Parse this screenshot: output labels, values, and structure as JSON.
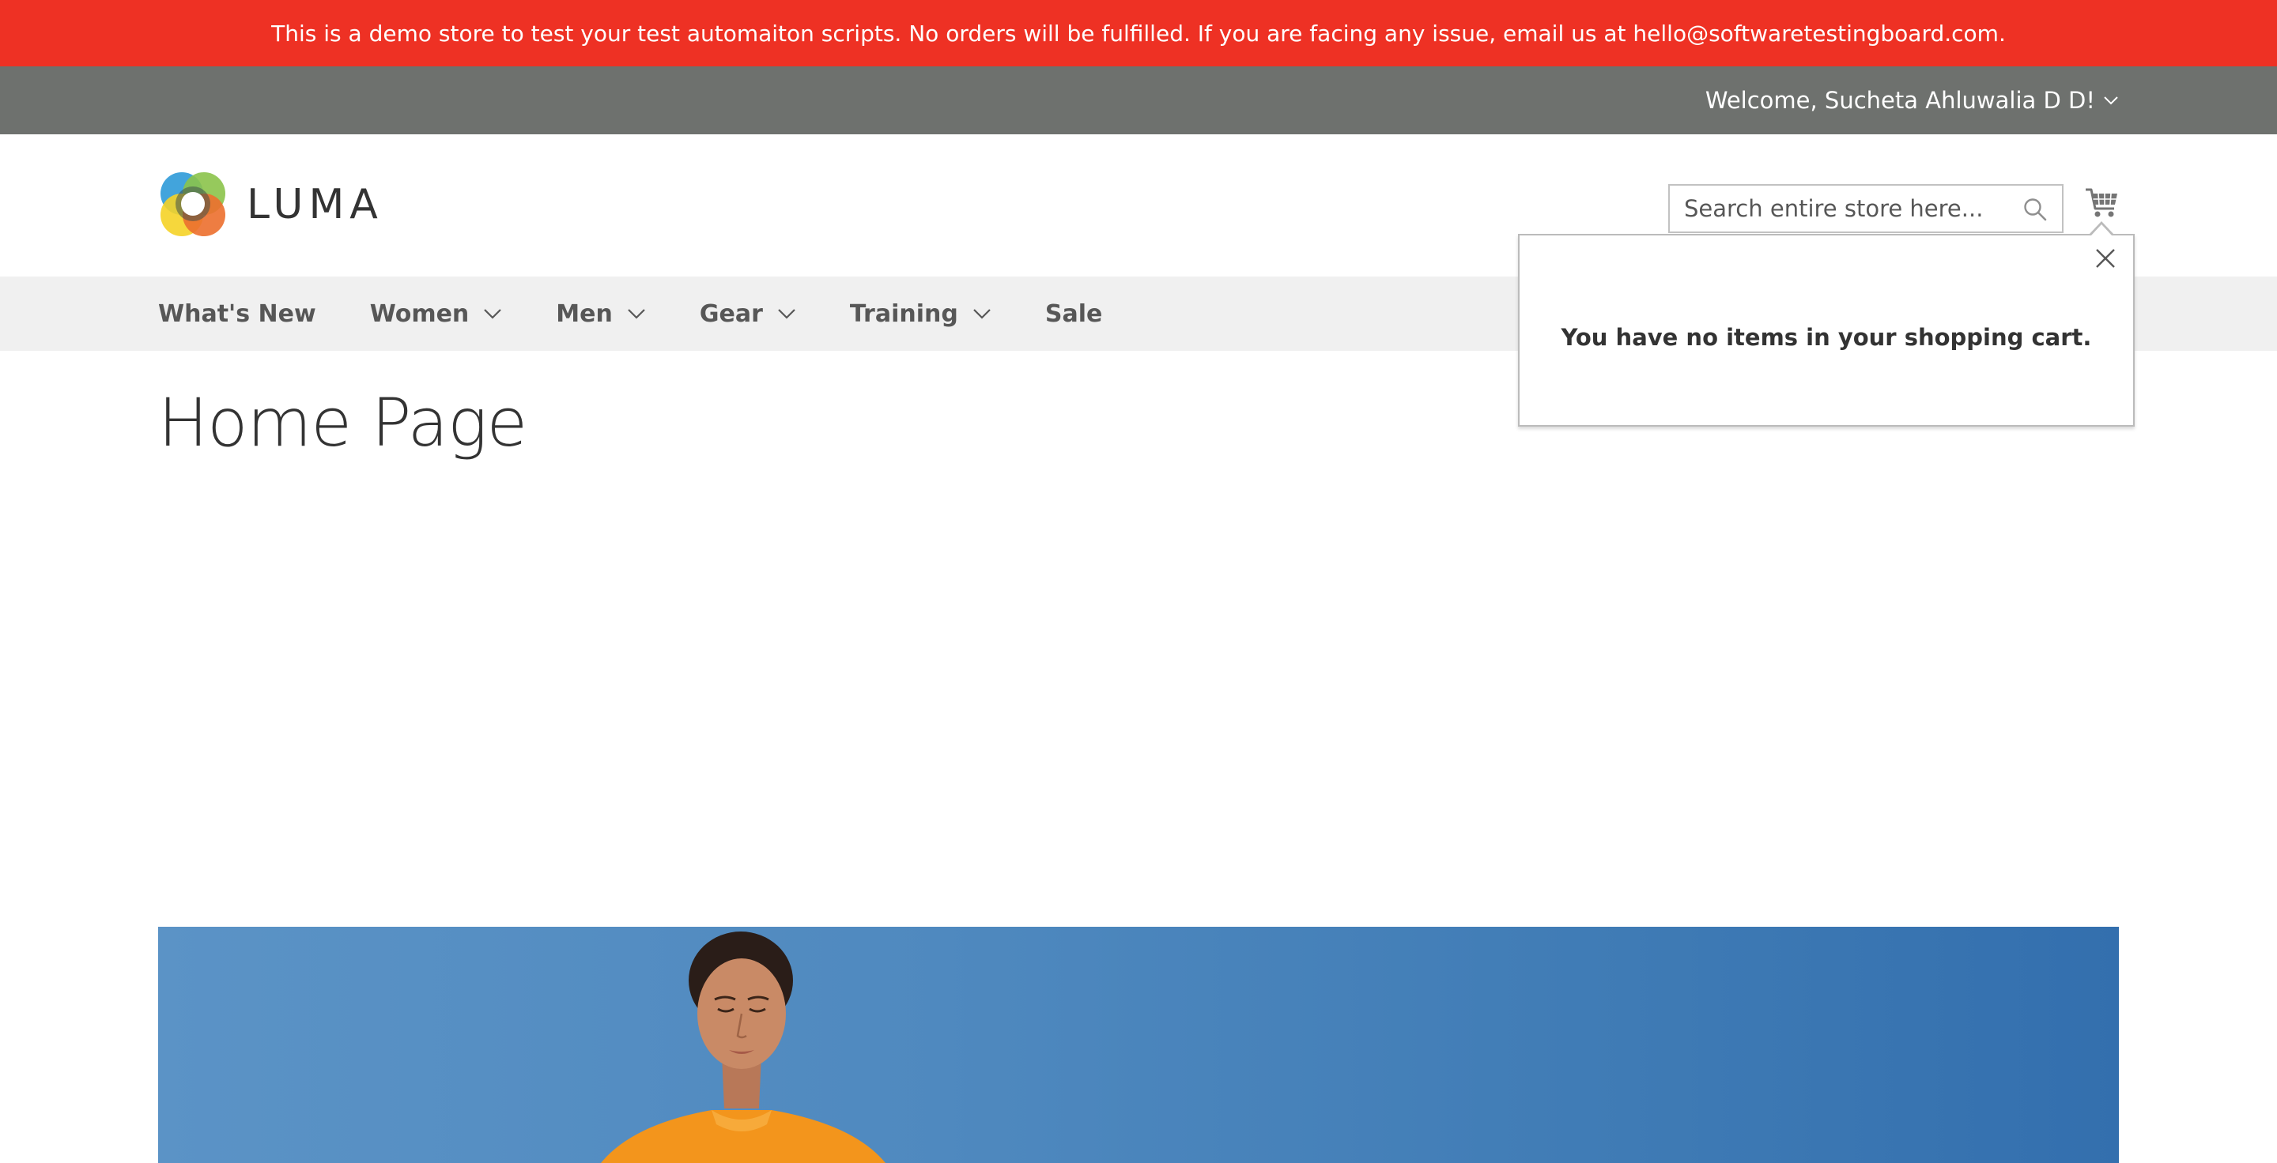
{
  "notice": {
    "text": "This is a demo store to test your test automaiton scripts. No orders will be fulfilled. If you are facing any issue, email us at hello@softwaretestingboard.com."
  },
  "header": {
    "welcome_text": "Welcome, Sucheta Ahluwalia D D!",
    "logo_text": "LUMA",
    "search": {
      "placeholder": "Search entire store here..."
    }
  },
  "nav": {
    "items": [
      {
        "label": "What's New",
        "has_submenu": false
      },
      {
        "label": "Women",
        "has_submenu": true
      },
      {
        "label": "Men",
        "has_submenu": true
      },
      {
        "label": "Gear",
        "has_submenu": true
      },
      {
        "label": "Training",
        "has_submenu": true
      },
      {
        "label": "Sale",
        "has_submenu": false
      }
    ]
  },
  "page": {
    "title": "Home Page"
  },
  "minicart": {
    "empty_message": "You have no items in your shopping cart."
  },
  "colors": {
    "notice_bg": "#ee3124",
    "panel_bg": "#6e716e",
    "nav_bg": "#f0f0f0",
    "hero_sky": "#4f89bf"
  },
  "icons": [
    "luma-logo-icon",
    "search-icon",
    "cart-icon",
    "close-icon",
    "chevron-down-icon"
  ]
}
